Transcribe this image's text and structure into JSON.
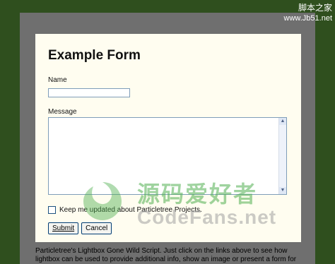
{
  "site_watermark": {
    "name": "脚本之家",
    "url": "www.Jb51.net"
  },
  "form": {
    "title": "Example Form",
    "name_label": "Name",
    "name_value": "",
    "message_label": "Message",
    "message_value": "",
    "checkbox_label": "Keep me updated about Particletree Projects.",
    "checkbox_checked": false,
    "submit_label": "Submit",
    "cancel_label": "Cancel"
  },
  "footer": {
    "text": "Particletree's Lightbox Gone Wild Script. Just click on the links above to see how lightbox can be used to provide additional info, show an image or present a form for"
  },
  "logo_watermark": {
    "cn": "源码爱好者",
    "en": "CodeFans.net"
  },
  "colors": {
    "outer_bg": "#2f4f1e",
    "frame_bg": "#6f6f6f",
    "lightbox_bg": "#fffdf0",
    "input_border": "#7f9db9"
  }
}
